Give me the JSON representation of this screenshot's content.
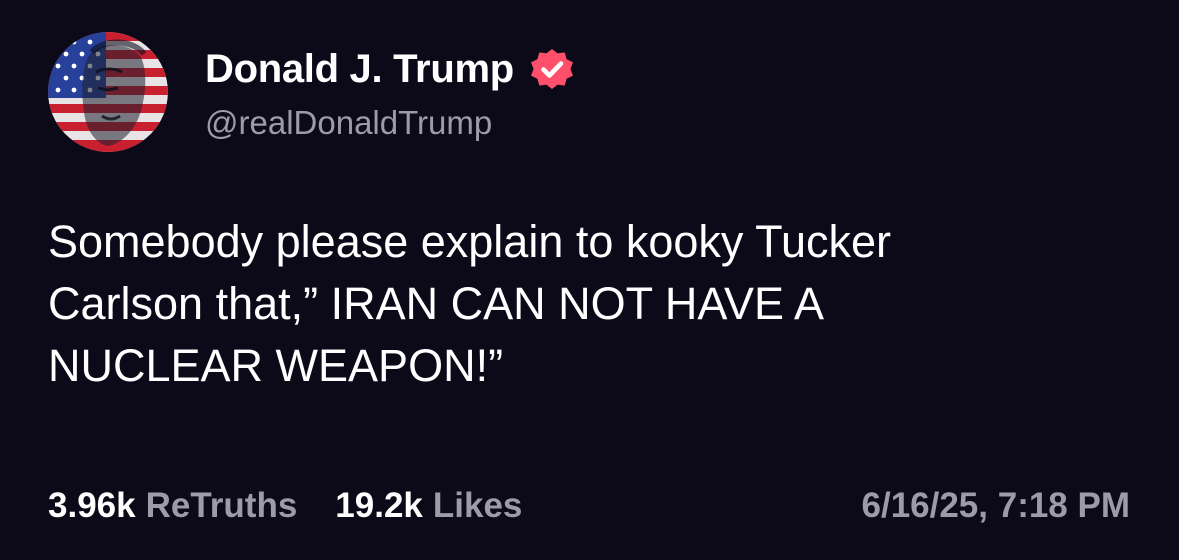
{
  "author": {
    "display_name": "Donald J. Trump",
    "handle": "@realDonaldTrump",
    "verified_icon": "verified-badge-icon",
    "avatar_icon": "flag-portrait-avatar"
  },
  "post": {
    "lines": [
      "Somebody please explain to kooky Tucker",
      "Carlson that,” IRAN CAN NOT HAVE A",
      "NUCLEAR WEAPON!”"
    ]
  },
  "stats": {
    "retruths_count": "3.96k",
    "retruths_label": "ReTruths",
    "likes_count": "19.2k",
    "likes_label": "Likes"
  },
  "timestamp": "6/16/25, 7:18 PM",
  "colors": {
    "background": "#0c0a19",
    "text_primary": "#ffffff",
    "text_secondary": "#9c9aab",
    "verified_badge": "#ff4f6a"
  }
}
